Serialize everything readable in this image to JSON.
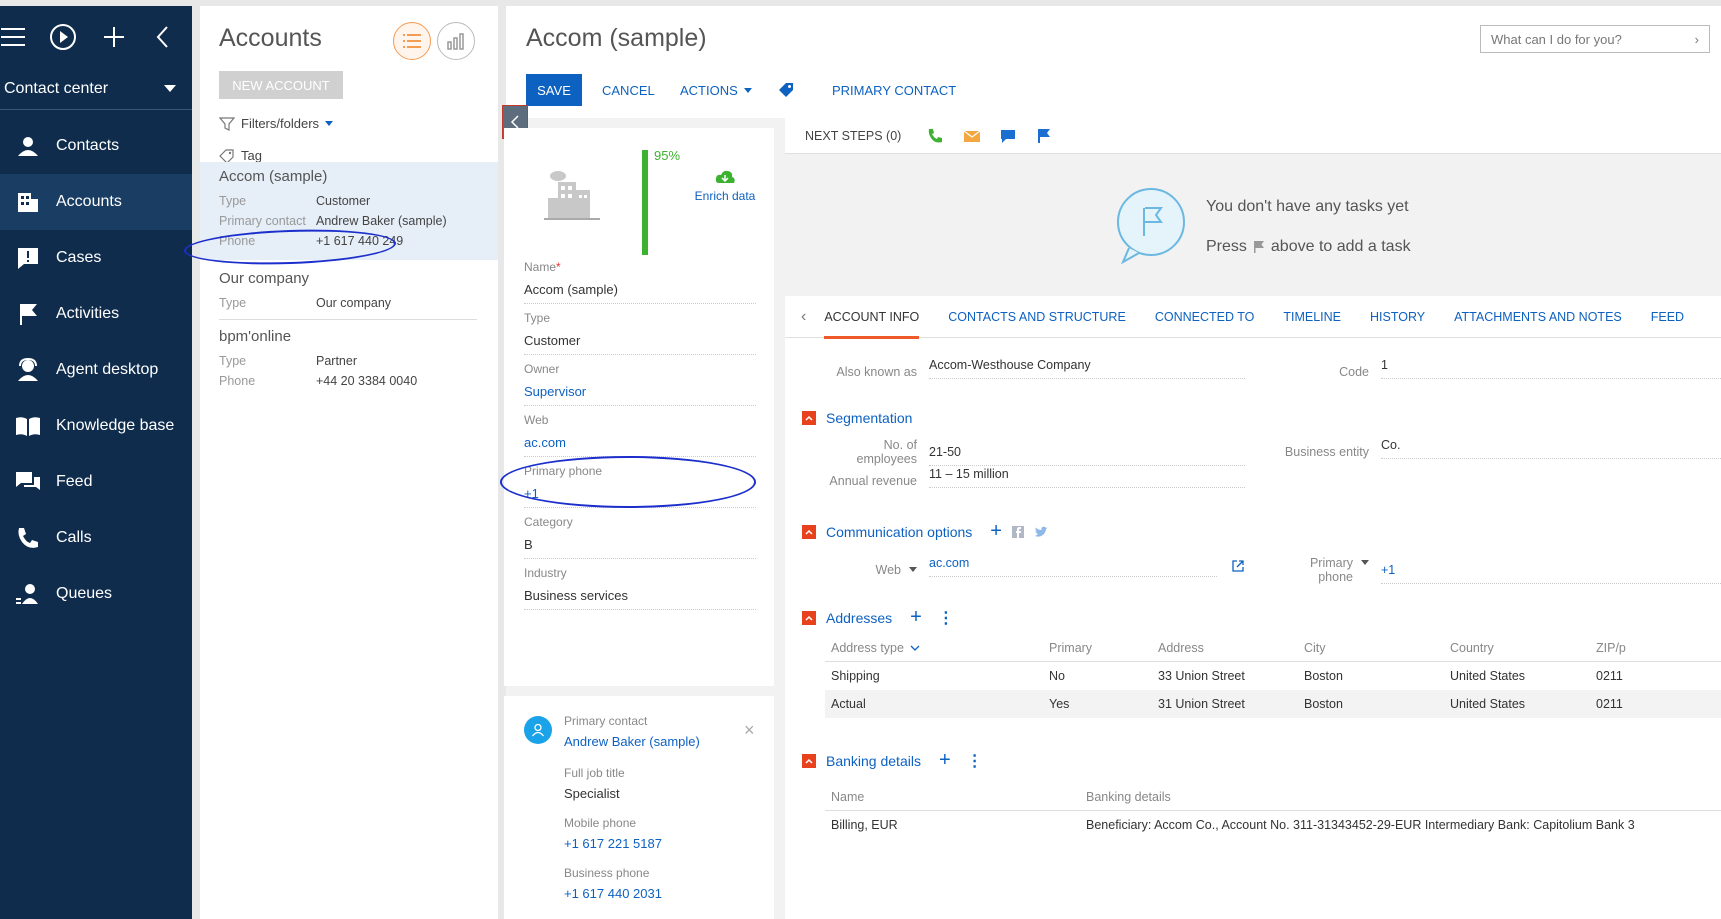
{
  "nav": {
    "workspace": "Contact center",
    "items": [
      {
        "label": "Contacts",
        "icon": "person-icon"
      },
      {
        "label": "Accounts",
        "icon": "building-icon"
      },
      {
        "label": "Cases",
        "icon": "alert-bubble-icon"
      },
      {
        "label": "Activities",
        "icon": "flag-icon"
      },
      {
        "label": "Agent desktop",
        "icon": "agent-icon"
      },
      {
        "label": "Knowledge base",
        "icon": "book-icon"
      },
      {
        "label": "Feed",
        "icon": "chat-icon"
      },
      {
        "label": "Calls",
        "icon": "phone-icon"
      },
      {
        "label": "Queues",
        "icon": "queue-icon"
      }
    ]
  },
  "list": {
    "title": "Accounts",
    "new_button": "NEW ACCOUNT",
    "filters": "Filters/folders",
    "tag": "Tag",
    "cards": [
      {
        "name": "Accom (sample)",
        "rows": [
          [
            "Type",
            "Customer"
          ],
          [
            "Primary contact",
            "Andrew Baker (sample)"
          ],
          [
            "Phone",
            "+1 617 440 249"
          ]
        ]
      },
      {
        "name": "Our company",
        "rows": [
          [
            "Type",
            "Our company"
          ]
        ]
      },
      {
        "name": "bpm'online",
        "rows": [
          [
            "Type",
            "Partner"
          ],
          [
            "Phone",
            "+44 20 3384 0040"
          ]
        ]
      }
    ]
  },
  "header": {
    "title": "Accom (sample)",
    "search_placeholder": "What can I do for you?",
    "save": "SAVE",
    "cancel": "CANCEL",
    "actions": "ACTIONS",
    "primary_contact": "PRIMARY CONTACT"
  },
  "profile": {
    "completeness": "95%",
    "completeness_value": 0.95,
    "enrich": "Enrich data",
    "fields": [
      {
        "label": "Name",
        "value": "Accom (sample)"
      },
      {
        "label": "Type",
        "value": "Customer"
      },
      {
        "label": "Owner",
        "value": "Supervisor"
      },
      {
        "label": "Web",
        "value": "ac.com"
      },
      {
        "label": "Primary phone",
        "value": "+1"
      },
      {
        "label": "Category",
        "value": "B"
      },
      {
        "label": "Industry",
        "value": "Business services"
      }
    ]
  },
  "contact": {
    "label": "Primary contact",
    "name": "Andrew Baker (sample)",
    "job_label": "Full job title",
    "job": "Specialist",
    "mobile_label": "Mobile phone",
    "mobile": "+1 617 221 5187",
    "business_label": "Business phone",
    "business": "+1 617 440 2031"
  },
  "next_steps": {
    "label": "NEXT STEPS (0)",
    "empty": "You don't have any tasks yet",
    "press": "Press",
    "press_tail": "above to add a task"
  },
  "tabs": [
    "ACCOUNT INFO",
    "CONTACTS AND STRUCTURE",
    "CONNECTED TO",
    "TIMELINE",
    "HISTORY",
    "ATTACHMENTS AND NOTES",
    "FEED"
  ],
  "info": {
    "aka_label": "Also known as",
    "aka": "Accom-Westhouse Company",
    "code_label": "Code",
    "code": "1",
    "segmentation": "Segmentation",
    "employees_label": "No. of employees",
    "employees": "21-50",
    "entity_label": "Business entity",
    "entity": "Co.",
    "revenue_label": "Annual revenue",
    "revenue": "11 – 15 million",
    "comm": "Communication options",
    "web_label": "Web",
    "web": "ac.com",
    "phone_label": "Primary phone",
    "phone": "+1",
    "addresses": "Addresses",
    "addr_headers": [
      "Address type",
      "Primary",
      "Address",
      "City",
      "Country",
      "ZIP/p"
    ],
    "addr_rows": [
      [
        "Shipping",
        "No",
        "33 Union Street",
        "Boston",
        "United States",
        "0211"
      ],
      [
        "Actual",
        "Yes",
        "31 Union Street",
        "Boston",
        "United States",
        "0211"
      ]
    ],
    "banking": "Banking details",
    "bank_headers": [
      "Name",
      "Banking details"
    ],
    "bank_rows": [
      [
        "Billing, EUR",
        "Beneficiary: Accom Co., Account No. 311-31343452-29-EUR Intermediary Bank: Capitolium Bank 3"
      ]
    ]
  }
}
